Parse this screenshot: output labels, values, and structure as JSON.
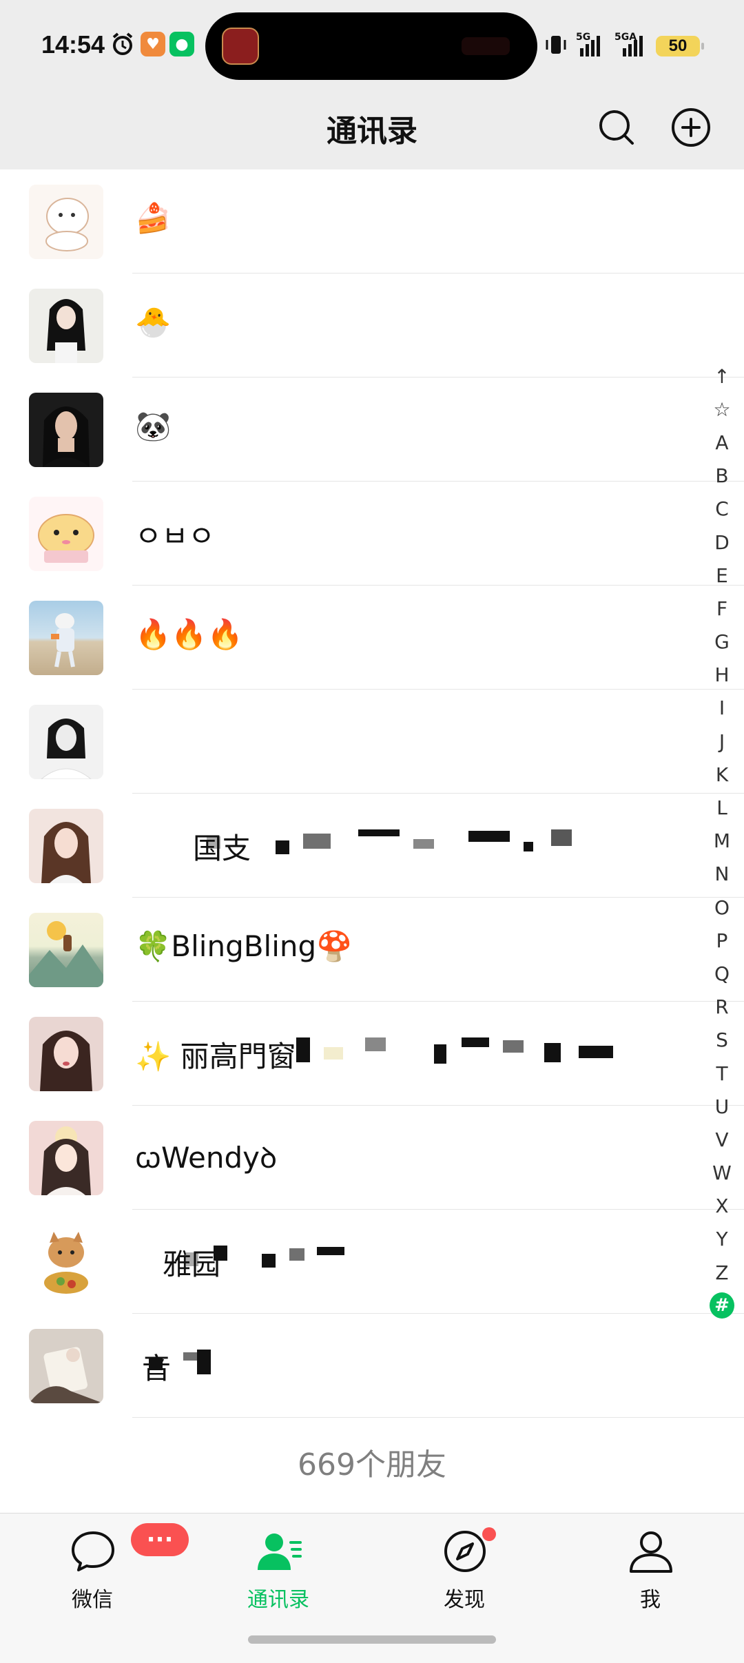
{
  "status_bar": {
    "time": "14:54",
    "network_1": "5G",
    "network_2": "5GA",
    "battery": "50",
    "icons": [
      "alarm-icon",
      "app-notification-icon",
      "wechat-notification-icon",
      "vibrate-icon"
    ]
  },
  "header": {
    "title": "通讯录",
    "search_icon": "search-icon",
    "add_icon": "plus-circle-icon"
  },
  "contacts": [
    {
      "name": "🍰",
      "redacted": false
    },
    {
      "name": "🐣",
      "redacted": false
    },
    {
      "name": "🐼",
      "redacted": false
    },
    {
      "name": "ㅇㅂㅇ",
      "redacted": false
    },
    {
      "name": "🔥🔥🔥",
      "redacted": false
    },
    {
      "name": "",
      "redacted": false
    },
    {
      "name": "国支",
      "redacted": true
    },
    {
      "name": "🍀BlingBling🍄",
      "redacted": false
    },
    {
      "name": "✨ 丽高門窗",
      "redacted": true
    },
    {
      "name": "ꞷWendyꝺ",
      "redacted": false
    },
    {
      "name": "雅园",
      "redacted": true
    },
    {
      "name": "音",
      "redacted": true
    }
  ],
  "index_bar": {
    "items": [
      "↑",
      "☆",
      "A",
      "B",
      "C",
      "D",
      "E",
      "F",
      "G",
      "H",
      "I",
      "J",
      "K",
      "L",
      "M",
      "N",
      "O",
      "P",
      "Q",
      "R",
      "S",
      "T",
      "U",
      "V",
      "W",
      "X",
      "Y",
      "Z"
    ],
    "active": "#"
  },
  "footer": {
    "friend_count": "669个朋友"
  },
  "tab_bar": {
    "tabs": [
      {
        "label": "微信",
        "icon": "chat-bubble-icon",
        "active": false,
        "badge": "···"
      },
      {
        "label": "通讯录",
        "icon": "contacts-icon",
        "active": true
      },
      {
        "label": "发现",
        "icon": "compass-icon",
        "active": false,
        "dot": true
      },
      {
        "label": "我",
        "icon": "person-icon",
        "active": false
      }
    ]
  },
  "colors": {
    "accent": "#07c160",
    "badge": "#fa5151",
    "header_bg": "#ededed",
    "battery": "#f3d45a"
  }
}
